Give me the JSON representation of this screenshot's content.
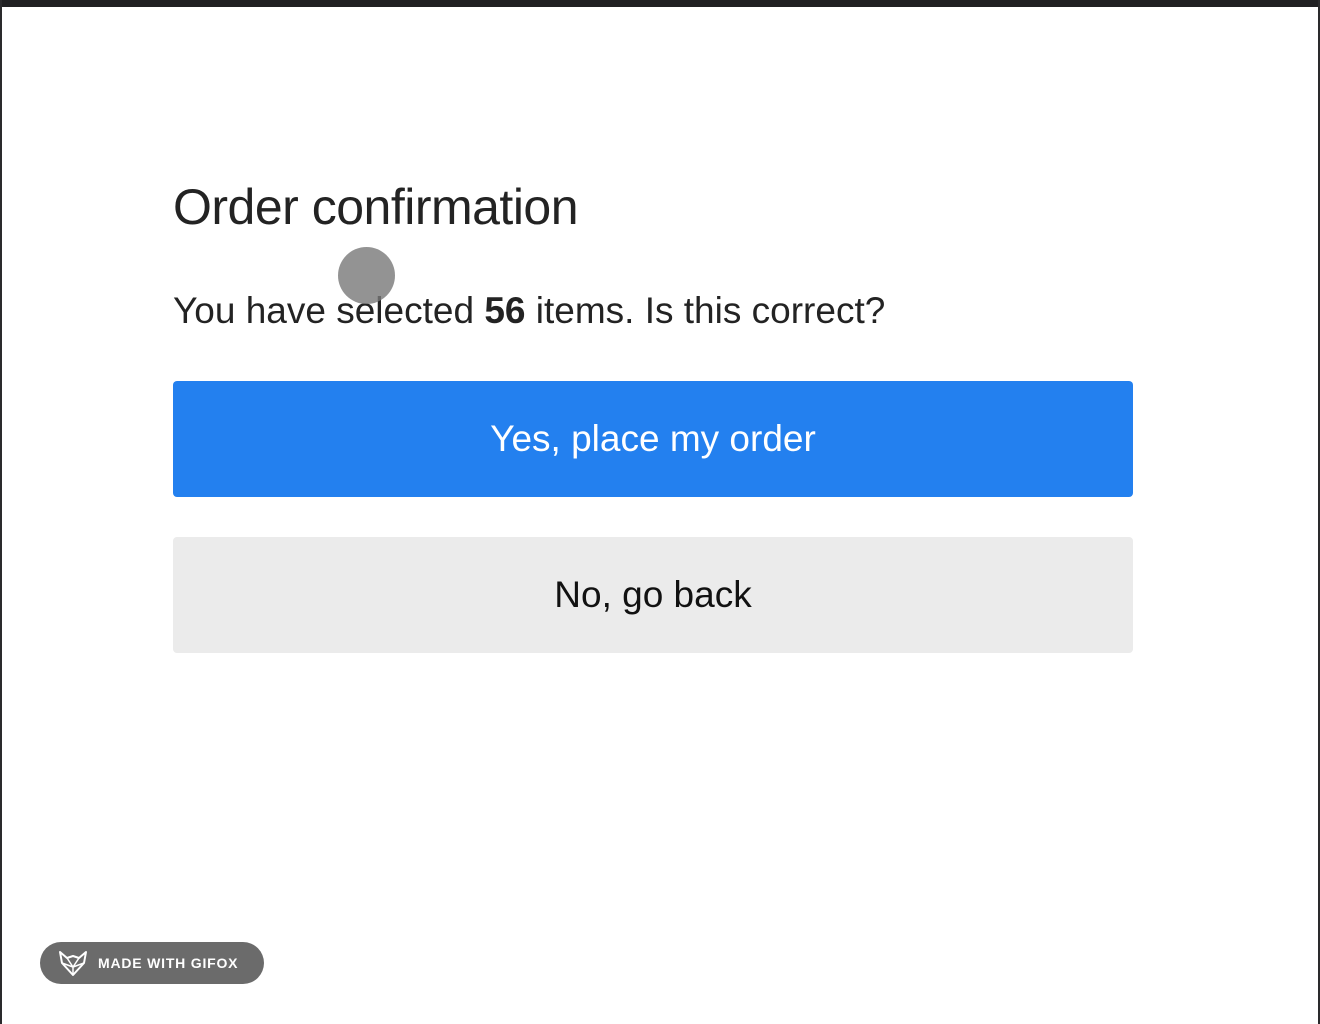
{
  "dialog": {
    "title": "Order confirmation",
    "question_before": "You have selected ",
    "item_count": "56",
    "question_after": " items. Is this correct?",
    "confirm_label": "Yes, place my order",
    "cancel_label": "No, go back"
  },
  "watermark": {
    "text": "MADE WITH GIFOX",
    "icon": "fox-icon"
  },
  "colors": {
    "primary": "#2380ef",
    "secondary": "#ebebeb",
    "text": "#232323"
  }
}
